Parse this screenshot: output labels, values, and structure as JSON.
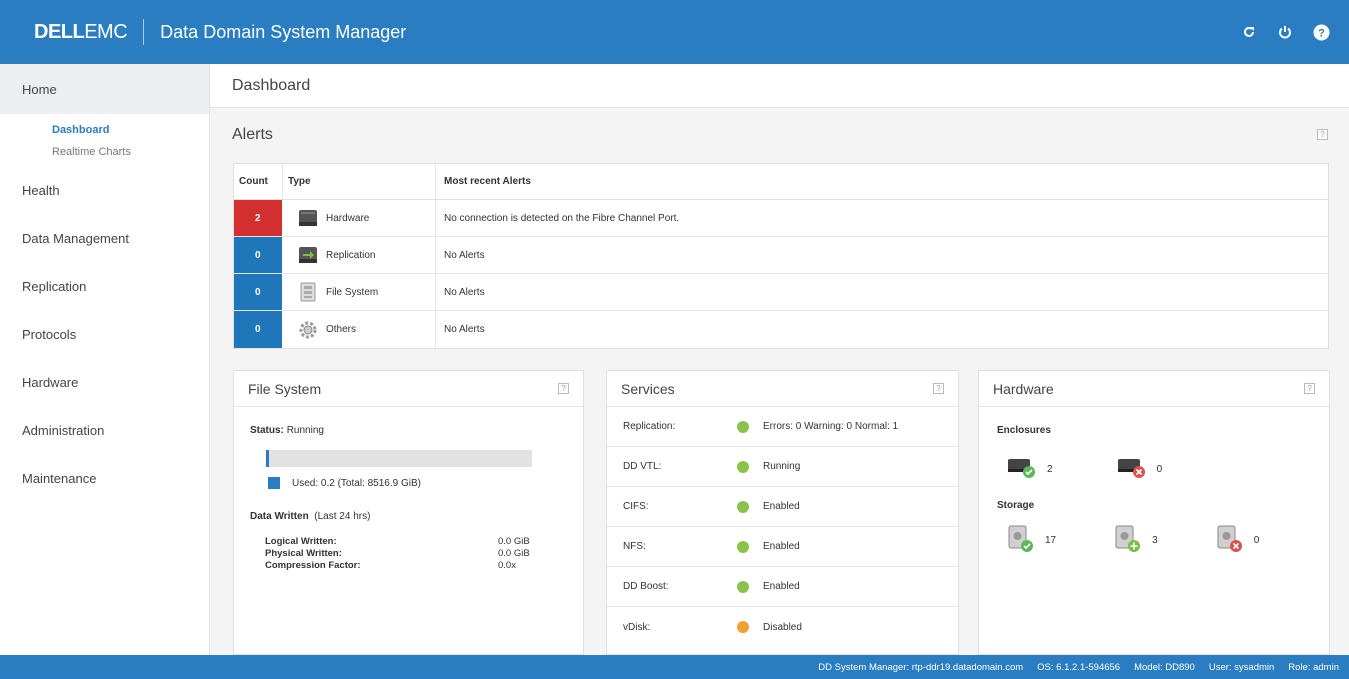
{
  "header": {
    "logo_bold": "DELL",
    "logo_thin": "EMC",
    "app_title": "Data Domain System Manager"
  },
  "sidebar": {
    "home": "Home",
    "sub_items": [
      "Dashboard",
      "Realtime Charts"
    ],
    "items": [
      "Health",
      "Data Management",
      "Replication",
      "Protocols",
      "Hardware",
      "Administration",
      "Maintenance"
    ]
  },
  "page": {
    "title": "Dashboard",
    "help": "?"
  },
  "alerts": {
    "title": "Alerts",
    "columns": {
      "count": "Count",
      "type": "Type",
      "recent": "Most recent Alerts"
    },
    "rows": [
      {
        "count": "2",
        "type": "Hardware",
        "message": "No connection is detected on the Fibre Channel Port.",
        "color": "#d32f2f"
      },
      {
        "count": "0",
        "type": "Replication",
        "message": "No Alerts",
        "color": "#1f76b8"
      },
      {
        "count": "0",
        "type": "File System",
        "message": "No Alerts",
        "color": "#1f76b8"
      },
      {
        "count": "0",
        "type": "Others",
        "message": "No Alerts",
        "color": "#1f76b8"
      }
    ]
  },
  "filesystem": {
    "title": "File System",
    "status_label": "Status:",
    "status_value": "Running",
    "used_fraction": 0.01,
    "legend": "Used: 0.2 (Total: 8516.9 GiB)",
    "data_written_label": "Data Written",
    "data_written_period": "(Last 24 hrs)",
    "rows": [
      {
        "label": "Logical Written:",
        "value": "0.0 GiB"
      },
      {
        "label": "Physical Written:",
        "value": "0.0 GiB"
      },
      {
        "label": "Compression Factor:",
        "value": "0.0x"
      }
    ]
  },
  "services": {
    "title": "Services",
    "rows": [
      {
        "name": "Replication:",
        "status": "Errors: 0 Warning: 0 Normal: 1",
        "color": "#8bc34a"
      },
      {
        "name": "DD VTL:",
        "status": "Running",
        "color": "#8bc34a"
      },
      {
        "name": "CIFS:",
        "status": "Enabled",
        "color": "#8bc34a"
      },
      {
        "name": "NFS:",
        "status": "Enabled",
        "color": "#8bc34a"
      },
      {
        "name": "DD Boost:",
        "status": "Enabled",
        "color": "#8bc34a"
      },
      {
        "name": "vDisk:",
        "status": "Disabled",
        "color": "#f0a030"
      }
    ]
  },
  "hardware": {
    "title": "Hardware",
    "enclosures_label": "Enclosures",
    "enclosures": {
      "ok": "2",
      "failed": "0"
    },
    "storage_label": "Storage",
    "storage": {
      "ok": "17",
      "spare": "3",
      "failed": "0"
    }
  },
  "footer": {
    "system_manager": "DD System Manager: rtp-ddr19.datadomain.com",
    "os": "OS: 6.1.2.1-594656",
    "model": "Model: DD890",
    "user": "User: sysadmin",
    "role": "Role: admin"
  }
}
